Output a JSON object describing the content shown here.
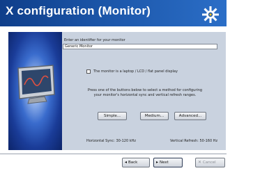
{
  "window": {
    "title": "X configuration (Monitor)"
  },
  "identifier": {
    "label": "Enter an identifier for your monitor",
    "value": "Generic Monitor"
  },
  "lcd_option": {
    "label": "The monitor is a laptop / LCD / flat panel display",
    "checked": false
  },
  "help_text": "Press one of the buttons below to select a method for configuring your monitor's horizontal sync and vertical refresh ranges.",
  "method_buttons": {
    "simple": "Simple...",
    "medium": "Medium...",
    "advanced": "Advanced..."
  },
  "ranges": {
    "horizontal_sync": "Horizontal Sync: 30-120 kHz",
    "vertical_refresh": "Vertical Refresh: 50-160 Hz"
  },
  "navigation": {
    "back": "Back",
    "next": "Next",
    "cancel": "Cancel"
  },
  "icons": [
    "gear-icon",
    "monitor-icon",
    "back-arrow-icon",
    "next-arrow-icon",
    "cancel-icon"
  ],
  "colors": {
    "title_bar": "#1b55a8",
    "panel": "#c9d2df",
    "art_panel": "#1a3c98"
  }
}
